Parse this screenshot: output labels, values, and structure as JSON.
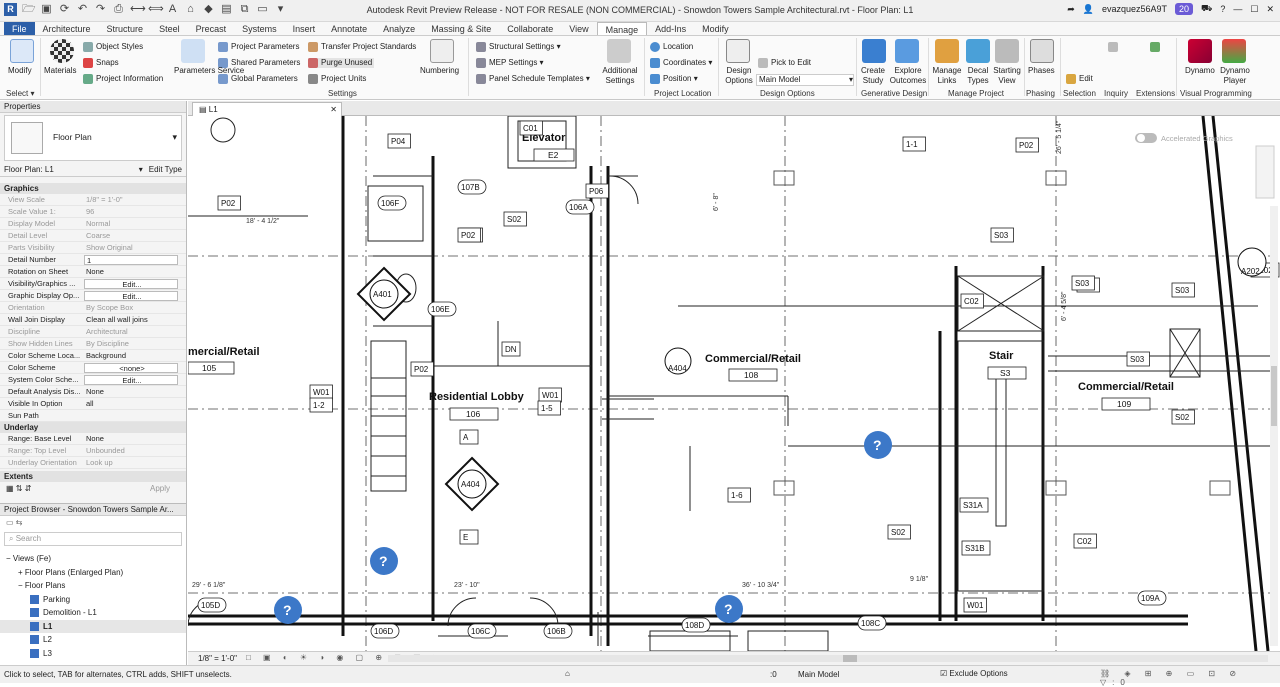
{
  "window": {
    "title": "Autodesk Revit Preview Release - NOT FOR RESALE (NON COMMERCIAL) - Snowdon Towers Sample Architectural.rvt - Floor Plan: L1",
    "user": "evazquez56A9T",
    "notifications": "20"
  },
  "tabs": [
    "File",
    "Architecture",
    "Structure",
    "Steel",
    "Precast",
    "Systems",
    "Insert",
    "Annotate",
    "Analyze",
    "Massing & Site",
    "Collaborate",
    "View",
    "Manage",
    "Add-Ins",
    "Modify"
  ],
  "ribbon": {
    "modify": "Modify",
    "select": "Select",
    "materials": "Materials",
    "object_styles": "Object Styles",
    "snaps": "Snaps",
    "project_information": "Project Information",
    "project_parameters": "Project Parameters",
    "shared_parameters": "Shared Parameters",
    "global_parameters": "Global Parameters",
    "parameters_service": "Parameters Service",
    "transfer_project_standards": "Transfer Project Standards",
    "purge_unused": "Purge Unused",
    "project_units": "Project Units",
    "settings_group": "Settings",
    "numbering": "Numbering",
    "structural_settings": "Structural Settings",
    "mep_settings": "MEP Settings",
    "panel_schedule_templates": "Panel Schedule Templates",
    "additional_settings": "Additional Settings",
    "location": "Location",
    "coordinates": "Coordinates",
    "position": "Position",
    "project_location_group": "Project Location",
    "design_options": "Design Options",
    "pick_to_edit": "Pick to Edit",
    "main_model": "Main Model",
    "design_options_group": "Design Options",
    "create_study": "Create Study",
    "explore_outcomes": "Explore Outcomes",
    "generative_design_group": "Generative Design",
    "manage_links": "Manage Links",
    "decal_types": "Decal Types",
    "starting_view": "Starting View",
    "manage_project_group": "Manage Project",
    "phases": "Phases",
    "phasing_group": "Phasing",
    "edit": "Edit",
    "selection_group": "Selection",
    "inquiry_group": "Inquiry",
    "extensions_group": "Extensions",
    "dynamo": "Dynamo",
    "dynamo_player": "Dynamo Player",
    "visual_programming_group": "Visual Programming"
  },
  "properties": {
    "title": "Properties",
    "type_name": "Floor Plan",
    "instance_selector": "Floor Plan: L1",
    "edit_type": "Edit Type",
    "graphics_cat": "Graphics",
    "rows": [
      {
        "k": "View Scale",
        "v": "1/8\" = 1'-0\"",
        "dis": true
      },
      {
        "k": "Scale Value    1:",
        "v": "96",
        "dis": true
      },
      {
        "k": "Display Model",
        "v": "Normal",
        "dis": true
      },
      {
        "k": "Detail Level",
        "v": "Coarse",
        "dis": true
      },
      {
        "k": "Parts Visibility",
        "v": "Show Original",
        "dis": true
      },
      {
        "k": "Detail Number",
        "v": "1",
        "box": true
      },
      {
        "k": "Rotation on Sheet",
        "v": "None"
      },
      {
        "k": "Visibility/Graphics ...",
        "v": "Edit...",
        "btn": true
      },
      {
        "k": "Graphic Display Op...",
        "v": "Edit...",
        "btn": true
      },
      {
        "k": "Orientation",
        "v": "By Scope Box",
        "dis": true
      },
      {
        "k": "Wall Join Display",
        "v": "Clean all wall joins"
      },
      {
        "k": "Discipline",
        "v": "Architectural",
        "dis": true
      },
      {
        "k": "Show Hidden Lines",
        "v": "By Discipline",
        "dis": true
      },
      {
        "k": "Color Scheme Loca...",
        "v": "Background"
      },
      {
        "k": "Color Scheme",
        "v": "<none>",
        "btn": true
      },
      {
        "k": "System Color Sche...",
        "v": "Edit...",
        "btn": true
      },
      {
        "k": "Default Analysis Dis...",
        "v": "None"
      },
      {
        "k": "Visible In Option",
        "v": "all"
      },
      {
        "k": "Sun Path",
        "v": ""
      }
    ],
    "underlay_cat": "Underlay",
    "underlay_rows": [
      {
        "k": "Range: Base Level",
        "v": "None"
      },
      {
        "k": "Range: Top Level",
        "v": "Unbounded",
        "dis": true
      },
      {
        "k": "Underlay Orientation",
        "v": "Look up",
        "dis": true
      }
    ],
    "extents_cat": "Extents",
    "apply": "Apply"
  },
  "browser": {
    "title": "Project Browser - Snowdon Towers Sample Ar...",
    "search": "Search",
    "items": [
      {
        "label": "Views (Fe)",
        "indent": 0,
        "sym": "−"
      },
      {
        "label": "Floor Plans (Enlarged Plan)",
        "indent": 1,
        "sym": "+"
      },
      {
        "label": "Floor Plans",
        "indent": 1,
        "sym": "−"
      },
      {
        "label": "Parking",
        "indent": 2,
        "sym": ""
      },
      {
        "label": "Demolition - L1",
        "indent": 2,
        "sym": ""
      },
      {
        "label": "L1",
        "indent": 2,
        "sym": "",
        "bold": true
      },
      {
        "label": "L2",
        "indent": 2,
        "sym": ""
      },
      {
        "label": "L3",
        "indent": 2,
        "sym": ""
      }
    ]
  },
  "view_tab": {
    "label": "L1"
  },
  "plan": {
    "rooms": [
      {
        "name": "Elevator",
        "num": "E2"
      },
      {
        "name": "Residential Lobby",
        "num": "106"
      },
      {
        "name": "Commercial/Retail",
        "num": "108"
      },
      {
        "name": "Commercial/Retail",
        "num": "109"
      },
      {
        "name": "mercial/Retail",
        "num": "105"
      },
      {
        "name": "Stair",
        "num": "S3"
      }
    ],
    "tags": [
      "P04",
      "P02",
      "107B",
      "106F",
      "P02",
      "S02",
      "106A",
      "P06",
      "P02",
      "S03",
      "106E",
      "A401",
      "DN",
      "P02",
      "W01",
      "W01",
      "A",
      "A404",
      "E",
      "S03",
      "C02",
      "S03",
      "S03",
      "S03",
      "S02",
      "S02",
      "C02",
      "S31A",
      "S31B",
      "W01",
      "P02",
      "109A",
      "105D",
      "106D",
      "106C",
      "106B",
      "108D",
      "108C",
      "1-1",
      "1-2",
      "1-5",
      "1-6",
      "A202",
      "A404",
      "C01"
    ],
    "dims": [
      "18' - 4 1/2\"",
      "29' - 6 1/8\"",
      "23' - 10\"",
      "36' - 10 3/4\"",
      "26' - 5 1/4\"",
      "6' - 8\"",
      "6' - 4 5/8\"",
      "9 1/8\""
    ],
    "accelerated_graphics": "Accelerated Graphics",
    "help": "?"
  },
  "view_controls": {
    "scale": "1/8\" = 1'-0\""
  },
  "status": {
    "hint": "Click to select, TAB for alternates, CTRL adds, SHIFT unselects.",
    "zero": ":0",
    "model": "Main Model",
    "exclude": "Exclude Options"
  }
}
